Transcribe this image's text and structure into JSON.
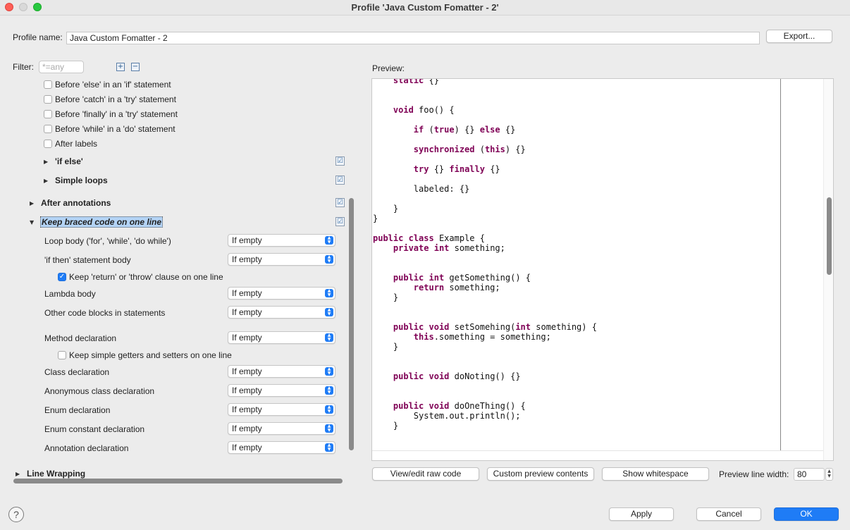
{
  "window": {
    "title": "Profile 'Java Custom Fomatter - 2'"
  },
  "profile": {
    "label": "Profile name:",
    "value": "Java Custom Fomatter - 2",
    "export_label": "Export..."
  },
  "filter": {
    "label": "Filter:",
    "placeholder": "*=any"
  },
  "preview": {
    "label": "Preview:"
  },
  "tree": {
    "before_else": "Before 'else' in an 'if' statement",
    "before_catch": "Before 'catch' in a 'try' statement",
    "before_finally": "Before 'finally' in a 'try' statement",
    "before_while": "Before 'while' in a 'do' statement",
    "after_labels": "After labels",
    "if_else": "'if else'",
    "simple_loops": "Simple loops",
    "after_annotations": "After annotations",
    "keep_braced": "Keep braced code on one line",
    "line_wrapping": "Line Wrapping"
  },
  "options": [
    {
      "label": "Loop body ('for', 'while', 'do while')",
      "value": "If empty"
    },
    {
      "label": "'if then' statement body",
      "value": "If empty"
    },
    {
      "label": "Lambda body",
      "value": "If empty"
    },
    {
      "label": "Other code blocks in statements",
      "value": "If empty"
    },
    {
      "label": "Method declaration",
      "value": "If empty"
    },
    {
      "label": "Class declaration",
      "value": "If empty"
    },
    {
      "label": "Anonymous class declaration",
      "value": "If empty"
    },
    {
      "label": "Enum declaration",
      "value": "If empty"
    },
    {
      "label": "Enum constant declaration",
      "value": "If empty"
    },
    {
      "label": "Annotation declaration",
      "value": "If empty"
    }
  ],
  "keep_return": "Keep 'return' or 'throw' clause on one line",
  "keep_getters": "Keep simple getters and setters on one line",
  "buttons": {
    "view_raw": "View/edit raw code",
    "custom_preview": "Custom preview contents",
    "show_whitespace": "Show whitespace",
    "preview_width_label": "Preview line width:",
    "preview_width_value": "80",
    "apply": "Apply",
    "cancel": "Cancel",
    "ok": "OK",
    "help": "?"
  },
  "code": {
    "l0_a": "static",
    "l0_b": " {}",
    "l1_a": "void",
    "l1_b": " foo() {",
    "l2_a": "if",
    "l2_b": " (",
    "l2_c": "true",
    "l2_d": ") {} ",
    "l2_e": "else",
    "l2_f": " {}",
    "l3_a": "synchronized",
    "l3_b": " (",
    "l3_c": "this",
    "l3_d": ") {}",
    "l4_a": "try",
    "l4_b": " {} ",
    "l4_c": "finally",
    "l4_d": " {}",
    "l5": "labeled: {}",
    "l6": "}",
    "l7": "}",
    "l8_a": "public",
    "l8_b": "class",
    "l8_c": " Example {",
    "l9_a": "private",
    "l9_b": "int",
    "l9_c": " something;",
    "l10_a": "public",
    "l10_b": "int",
    "l10_c": " getSomething() {",
    "l11_a": "return",
    "l11_b": " something;",
    "l12": "}",
    "l13_a": "public",
    "l13_b": "void",
    "l13_c": " setSomehing(",
    "l13_d": "int",
    "l13_e": " something) {",
    "l14_a": "this",
    "l14_b": ".something = something;",
    "l15": "}",
    "l16_a": "public",
    "l16_b": "void",
    "l16_c": " doNoting() {}",
    "l17_a": "public",
    "l17_b": "void",
    "l17_c": " doOneThing() {",
    "l18": "System.out.println();",
    "l19": "}"
  }
}
